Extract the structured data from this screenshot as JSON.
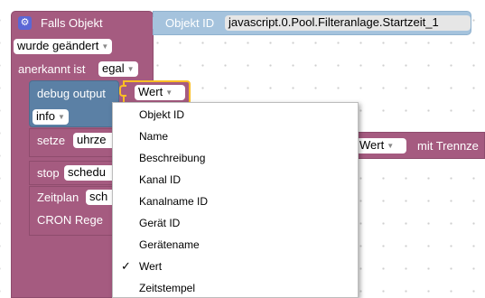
{
  "event_block": {
    "gear_icon": "gear-icon",
    "title": "Falls Objekt",
    "trigger_value": "wurde geändert",
    "ack_label": "anerkannt ist",
    "ack_value": "egal"
  },
  "object_block": {
    "label": "Objekt ID",
    "value": "javascript.0.Pool.Filteranlage.Startzeit_1"
  },
  "debug_block": {
    "label": "debug output",
    "value": "Wert",
    "level": "info"
  },
  "setze_block": {
    "label": "setze",
    "value": "uhrze"
  },
  "stop_block": {
    "label": "stop",
    "value": "schedu"
  },
  "zeitplan_block": {
    "label": "Zeitplan",
    "value": "sch",
    "cron_label": "CRON Rege"
  },
  "right_block": {
    "value": "Wert",
    "label": "mit Trennze"
  },
  "dropdown": {
    "items": [
      {
        "label": "Objekt ID",
        "checked": false
      },
      {
        "label": "Name",
        "checked": false
      },
      {
        "label": "Beschreibung",
        "checked": false
      },
      {
        "label": "Kanal ID",
        "checked": false
      },
      {
        "label": "Kanalname ID",
        "checked": false
      },
      {
        "label": "Gerät ID",
        "checked": false
      },
      {
        "label": "Gerätename",
        "checked": false
      },
      {
        "label": "Wert",
        "checked": true
      },
      {
        "label": "Zeitstempel",
        "checked": false
      }
    ],
    "check_mark": "✓"
  },
  "colors": {
    "event_block": "#a55b80",
    "event_block_border": "#8e4c6d",
    "object_block": "#a5c3dd",
    "debug_block": "#5b80a5",
    "selected_border": "#fbbf24",
    "menu_bg": "#ffffff"
  }
}
